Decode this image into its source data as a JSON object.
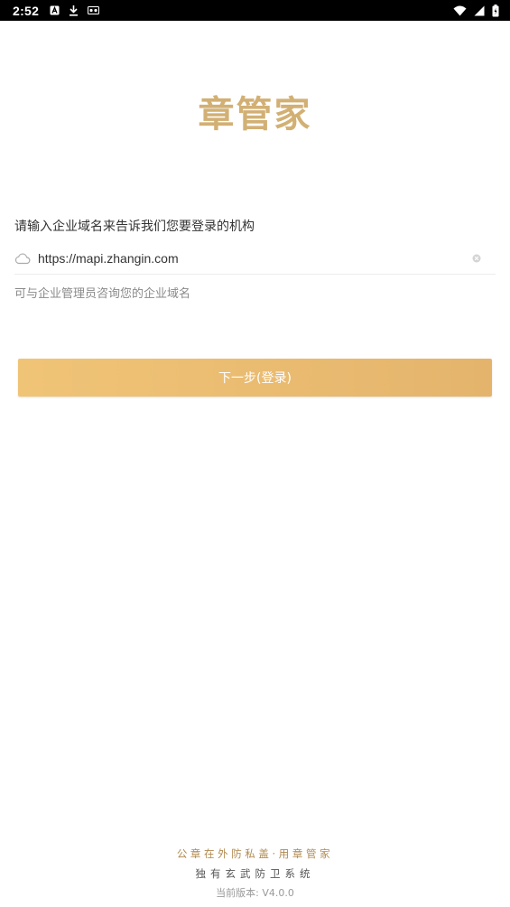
{
  "status_bar": {
    "time": "2:52",
    "left_icons": [
      "a-icon",
      "download-icon",
      "tape-icon"
    ],
    "right_icons": [
      "wifi-icon",
      "signal-icon",
      "battery-icon"
    ]
  },
  "logo": {
    "text": "章管家"
  },
  "login": {
    "prompt": "请输入企业域名来告诉我们您要登录的机构",
    "url_value": "https://mapi.zhangin.com",
    "hint": "可与企业管理员咨询您的企业域名",
    "next_label": "下一步(登录)"
  },
  "footer": {
    "slogan": "公章在外防私盖·用章管家",
    "slogan2": "独有玄武防卫系统",
    "version": "当前版本: V4.0.0"
  },
  "colors": {
    "brand_gold": "#d2b074",
    "button_start": "#f0c477",
    "button_end": "#e4b46c"
  }
}
